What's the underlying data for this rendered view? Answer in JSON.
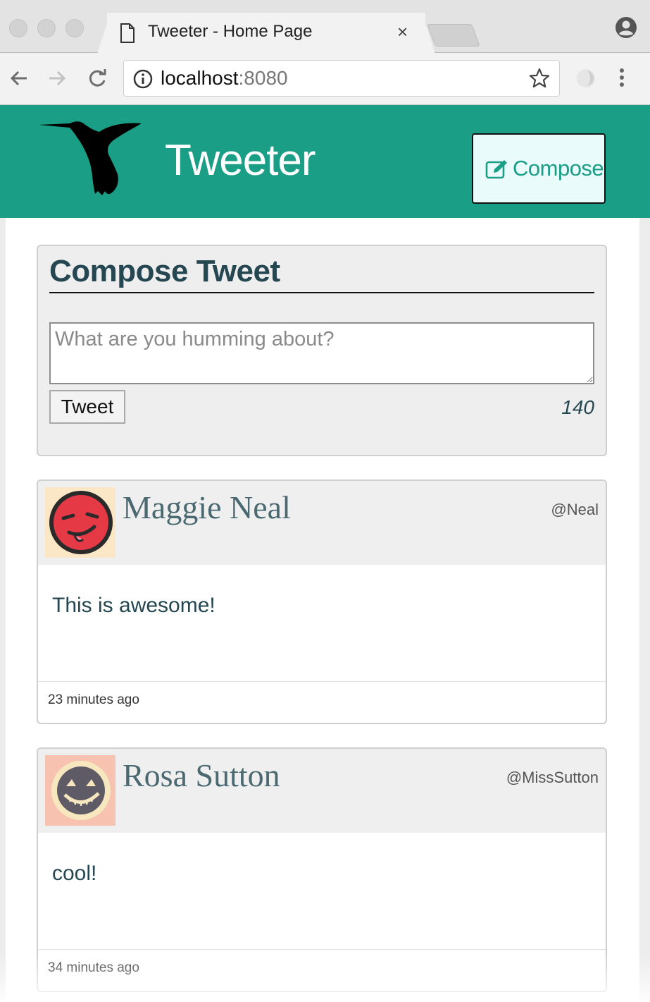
{
  "browser": {
    "tab_title": "Tweeter - Home Page",
    "tab_close": "×",
    "url_host": "localhost",
    "url_port": ":8080",
    "icons": [
      "page-icon",
      "profile-icon",
      "back-icon",
      "forward-icon",
      "reload-icon",
      "info-icon",
      "star-icon",
      "extension-icon",
      "menu-icon"
    ]
  },
  "header": {
    "brand": "Tweeter",
    "compose_label": "Compose",
    "background_color": "#1a9e86"
  },
  "compose": {
    "title": "Compose Tweet",
    "placeholder": "What are you humming about?",
    "submit_label": "Tweet",
    "counter": "140"
  },
  "tweets": [
    {
      "name": "Maggie Neal",
      "handle": "@Neal",
      "content": "This is awesome!",
      "time": "23 minutes ago",
      "avatar_bg": "#fbe7c6",
      "avatar_face": "#e63946"
    },
    {
      "name": "Rosa Sutton",
      "handle": "@MissSutton",
      "content": "cool!",
      "time": "34 minutes ago",
      "avatar_bg": "#f7c3b0",
      "avatar_face": "#5e5a66"
    }
  ]
}
